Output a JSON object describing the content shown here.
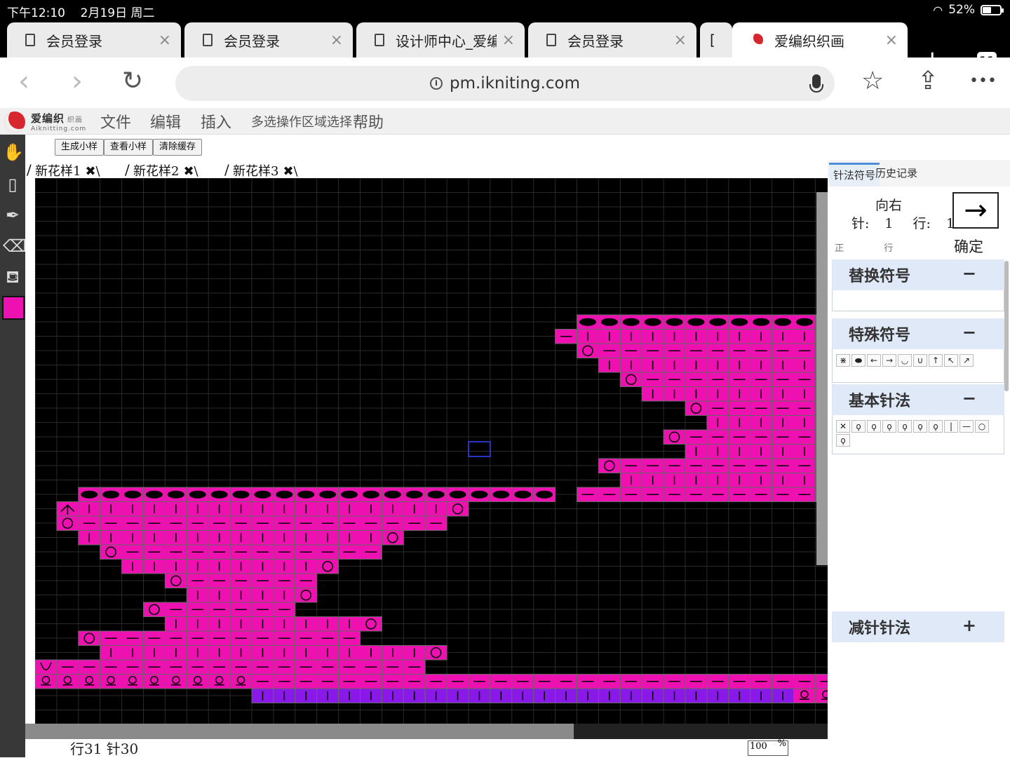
{
  "status_bar": {
    "time": "下午12:10",
    "date": "2月19日 周二",
    "battery": "52%",
    "battery_level": 0.52
  },
  "browser": {
    "tabs": [
      {
        "title": "会员登录",
        "close": "×"
      },
      {
        "title": "会员登录",
        "close": "×"
      },
      {
        "title": "设计师中心_爱编",
        "close": "×"
      },
      {
        "title": "会员登录",
        "close": "×"
      },
      {
        "title": "[",
        "close": ""
      },
      {
        "title": "爱编织织画",
        "close": "×"
      }
    ],
    "new_tab": "+",
    "tab_count": "11",
    "back": "‹",
    "forward": "›",
    "reload": "↻",
    "url": "pm.ikniting.com",
    "info_icon": "i",
    "bookmark": "☆",
    "share": "⇪",
    "more": "•••"
  },
  "app": {
    "logo_main": "爱编织",
    "logo_small": "织画",
    "logo_sub": "Aiknitting.com",
    "menu": [
      "文件",
      "编辑",
      "插入",
      "多选操作",
      "区域选择",
      "帮助"
    ],
    "subbuttons": [
      "生成小样",
      "查看小样",
      "清除缓存"
    ],
    "left_tools": [
      "hand-icon",
      "eraser-block-icon",
      "pen-icon",
      "eraser-icon",
      "fill-icon"
    ],
    "current_color": "#ee10b0",
    "chart_tabs": [
      {
        "label": "新花样1",
        "close": "✖"
      },
      {
        "label": "新花样2",
        "close": "✖"
      },
      {
        "label": "新花样3",
        "close": "✖"
      }
    ],
    "readout": "行31  针30",
    "zoom": "100",
    "zoom_unit": "%"
  },
  "panel": {
    "tabs": [
      "针法符号",
      "历史记录"
    ],
    "direction_label": "向右",
    "needle_label": "针:",
    "needle_value": "1",
    "row_label": "行:",
    "row_value": "1",
    "arrow": "→",
    "confirm": "确定",
    "input_pos_placeholder": "正",
    "input_row_placeholder": "行",
    "sections": [
      {
        "title": "替换符号",
        "toggle": "−",
        "symbols": []
      },
      {
        "title": "特殊符号",
        "toggle": "−",
        "symbols": [
          "⋇",
          "⬬",
          "←",
          "→",
          "◡",
          "∪",
          "↑",
          "↖",
          "↗"
        ]
      },
      {
        "title": "基本针法",
        "toggle": "−",
        "symbols": [
          "✕",
          "ϙ",
          "ϙ",
          "ϙ",
          "ϙ",
          "ϙ",
          "ϙ",
          "|",
          "—",
          "○",
          "ϙ"
        ]
      },
      {
        "title": "减针针法",
        "toggle": "+",
        "symbols": []
      }
    ]
  },
  "colors": {
    "stitch_pink": "#ee10b0",
    "stitch_purple": "#8a18e8",
    "canvas_bg": "#000000"
  }
}
